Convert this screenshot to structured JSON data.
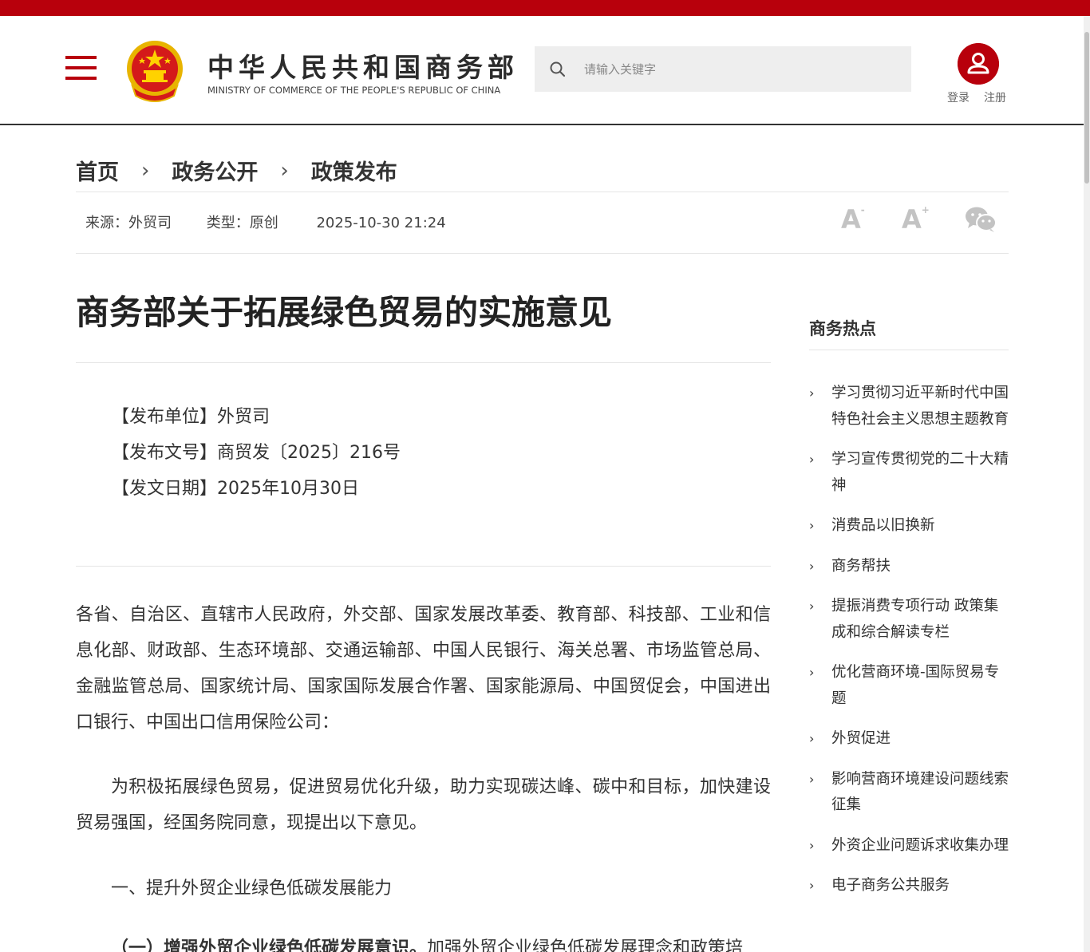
{
  "colors": {
    "brand": "#b8000c",
    "text": "#333333",
    "muted": "#c3c3c3"
  },
  "header": {
    "title_cn": "中华人民共和国商务部",
    "title_en": "MINISTRY OF COMMERCE OF THE PEOPLE'S REPUBLIC OF CHINA",
    "search_placeholder": "请输入关键字",
    "login": "登录",
    "register": "注册",
    "icons": [
      "menu-icon",
      "national-emblem",
      "search-icon",
      "user-icon"
    ]
  },
  "breadcrumb": [
    {
      "label": "首页"
    },
    {
      "label": "政务公开"
    },
    {
      "label": "政策发布"
    }
  ],
  "meta": {
    "source": "来源：外贸司",
    "type": "类型：原创",
    "date": "2025-10-30 21:24",
    "font_up": "A",
    "font_down": "A",
    "plus": "+",
    "minus": "-"
  },
  "article": {
    "title": "商务部关于拓展绿色贸易的实施意见",
    "publisher": "【发布单位】外贸司",
    "doc_number": "【发布文号】商贸发〔2025〕216号",
    "doc_date": "【发文日期】2025年10月30日",
    "p1": "各省、自治区、直辖市人民政府，外交部、国家发展改革委、教育部、科技部、工业和信息化部、财政部、生态环境部、交通运输部、中国人民银行、海关总署、市场监管总局、金融监管总局、国家统计局、国家国际发展合作署、国家能源局、中国贸促会，中国进出口银行、中国出口信用保险公司：",
    "p2": "为积极拓展绿色贸易，促进贸易优化升级，助力实现碳达峰、碳中和目标，加快建设贸易强国，经国务院同意，现提出以下意见。",
    "p3": "一、提升外贸企业绿色低碳发展能力",
    "p4_bold": "（一）增强外贸企业绿色低碳发展意识。",
    "p4_rest": "加强外贸企业绿色低碳发展理念和政策培"
  },
  "sidebar": {
    "title": "商务热点",
    "items": [
      {
        "label": "学习贯彻习近平新时代中国特色社会主义思想主题教育"
      },
      {
        "label": "学习宣传贯彻党的二十大精神"
      },
      {
        "label": "消费品以旧换新"
      },
      {
        "label": "商务帮扶"
      },
      {
        "label": "提振消费专项行动 政策集成和综合解读专栏"
      },
      {
        "label": "优化营商环境-国际贸易专题"
      },
      {
        "label": "外贸促进"
      },
      {
        "label": "影响营商环境建设问题线索征集"
      },
      {
        "label": "外资企业问题诉求收集办理"
      },
      {
        "label": "电子商务公共服务"
      }
    ]
  }
}
